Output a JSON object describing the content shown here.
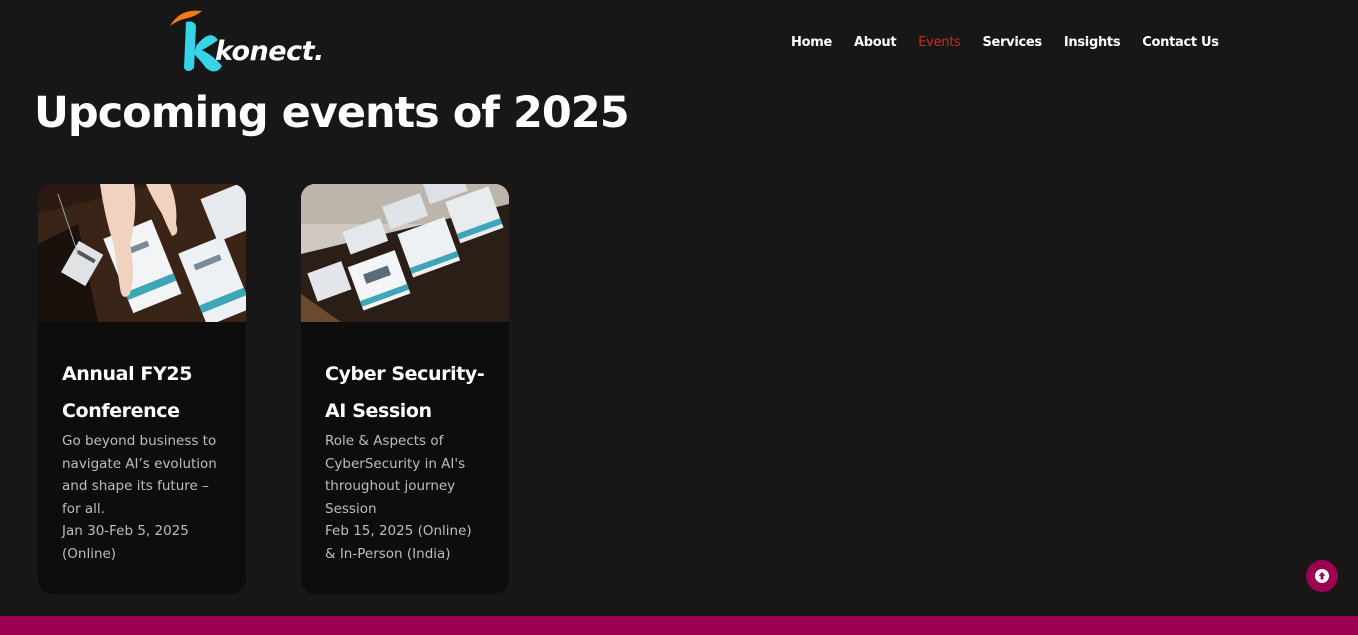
{
  "brand": {
    "name": "konect."
  },
  "nav": {
    "items": [
      {
        "label": "Home"
      },
      {
        "label": "About"
      },
      {
        "label": "Events",
        "active": true
      },
      {
        "label": "Services"
      },
      {
        "label": "Insights"
      },
      {
        "label": "Contact Us"
      }
    ]
  },
  "page": {
    "title": "Upcoming events of 2025"
  },
  "events": [
    {
      "title_line1": "Annual FY25",
      "title_line2": "Conference",
      "description": "Go beyond business to navigate AI’s evolution and shape its future – for all.",
      "date": "Jan 30-Feb 5, 2025 (Online)"
    },
    {
      "title_line1": "Cyber Security-",
      "title_line2": "AI Session",
      "description": "Role & Aspects of CyberSecurity in AI's throughout journey Session",
      "date": "Feb 15, 2025 (Online) & In-Person (India)"
    }
  ],
  "colors": {
    "background": "#171717",
    "card": "#0d0d0d",
    "accent": "#9c0050",
    "nav_active": "#c8282d",
    "logo_cyan": "#36d4e6",
    "logo_orange": "#f07a1a"
  },
  "icons": {
    "scroll_top": "arrow-up-circle-icon"
  }
}
